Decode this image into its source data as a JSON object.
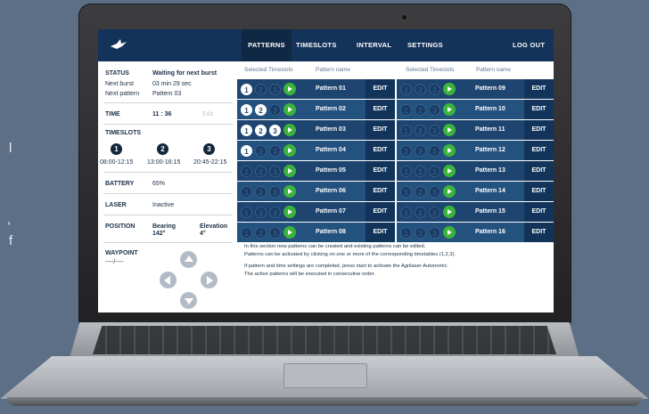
{
  "background_text": {
    "line1": "l",
    "line2": ",",
    "line3": "f"
  },
  "nav": {
    "patterns": "PATTERNS",
    "timeslots": "TIMESLOTS",
    "interval": "INTERVAL",
    "settings": "SETTINGS",
    "logout": "LOG OUT"
  },
  "status": {
    "status_label": "STATUS",
    "status_value": "Waiting for next burst",
    "next_burst_label": "Next burst",
    "next_burst_value": "03 min 29 sec",
    "next_pattern_label": "Next pattern",
    "next_pattern_value": "Pattern 03",
    "time_label": "TIME",
    "time_value": "11 : 36",
    "time_edit": "Edit",
    "timeslots_label": "TIMESLOTS",
    "slots": [
      {
        "num": "1",
        "range": "08:00-12:15"
      },
      {
        "num": "2",
        "range": "13:00-16:15"
      },
      {
        "num": "3",
        "range": "20:45-22:15"
      }
    ],
    "battery_label": "BATTERY",
    "battery_value": "65%",
    "laser_label": "LASER",
    "laser_value": "Inactive",
    "position_label": "POSITION",
    "bearing_label": "Bearing",
    "bearing_value": "142°",
    "elevation_label": "Elevation",
    "elevation_value": "4°",
    "waypoint_label": "WAYPOINT",
    "waypoint_value": "----/----"
  },
  "table": {
    "header_timeslots": "Selected Timeslots",
    "header_name": "Pattern name",
    "edit_label": "EDIT",
    "left": [
      {
        "name": "Pattern 01",
        "on": [
          true,
          false,
          false
        ]
      },
      {
        "name": "Pattern 02",
        "on": [
          true,
          true,
          false
        ]
      },
      {
        "name": "Pattern 03",
        "on": [
          true,
          true,
          true
        ]
      },
      {
        "name": "Pattern 04",
        "on": [
          true,
          false,
          false
        ]
      },
      {
        "name": "Pattern 05",
        "on": [
          false,
          false,
          false
        ]
      },
      {
        "name": "Pattern 06",
        "on": [
          false,
          false,
          false
        ]
      },
      {
        "name": "Pattern 07",
        "on": [
          false,
          false,
          false
        ]
      },
      {
        "name": "Pattern 08",
        "on": [
          false,
          false,
          false
        ]
      }
    ],
    "right": [
      {
        "name": "Pattern 09",
        "on": [
          false,
          false,
          false
        ]
      },
      {
        "name": "Pattern 10",
        "on": [
          false,
          false,
          false
        ]
      },
      {
        "name": "Pattern 11",
        "on": [
          false,
          false,
          false
        ]
      },
      {
        "name": "Pattern 12",
        "on": [
          false,
          false,
          false
        ]
      },
      {
        "name": "Pattern 13",
        "on": [
          false,
          false,
          false
        ]
      },
      {
        "name": "Pattern 14",
        "on": [
          false,
          false,
          false
        ]
      },
      {
        "name": "Pattern 15",
        "on": [
          false,
          false,
          false
        ]
      },
      {
        "name": "Pattern 16",
        "on": [
          false,
          false,
          false
        ]
      }
    ]
  },
  "info": {
    "line1": "In this section new patterns can be created and existing patterns can be edited.",
    "line2": "Patterns can be activated by clicking on one or more of the corresponding timetables (1,2,3).",
    "line3": "If pattern and time settings are completed, press start to activate the Agrilaser Autonomic.",
    "line4": "The active patterns will be executed in consecutive order."
  },
  "colors": {
    "nav_bg": "#14335a",
    "row_bg": "#1e4470",
    "play_green": "#3cb43c"
  }
}
